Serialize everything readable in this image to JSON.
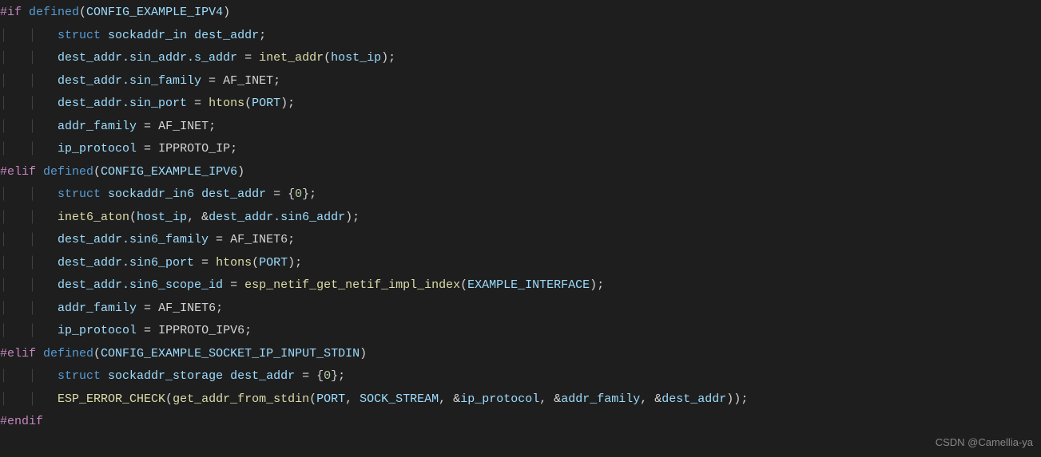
{
  "lines": {
    "l1": {
      "pre": "#if",
      "defkw": " defined",
      "op": "(",
      "macro": "CONFIG_EXAMPLE_IPV4",
      "cp": ")"
    },
    "l2": {
      "indent": "        ",
      "kw": "struct",
      "sp": " ",
      "type": "sockaddr_in",
      "sp2": " ",
      "name": "dest_addr",
      "semi": ";"
    },
    "l3": {
      "indent": "        ",
      "lhs": "dest_addr.sin_addr.s_addr",
      "eq": " = ",
      "fn": "inet_addr",
      "op": "(",
      "arg": "host_ip",
      "cp": ")",
      "semi": ";"
    },
    "l4": {
      "indent": "        ",
      "lhs": "dest_addr.sin_family",
      "eq": " = ",
      "rhs": "AF_INET",
      "semi": ";"
    },
    "l5": {
      "indent": "        ",
      "lhs": "dest_addr.sin_port",
      "eq": " = ",
      "fn": "htons",
      "op": "(",
      "arg": "PORT",
      "cp": ")",
      "semi": ";"
    },
    "l6": {
      "indent": "        ",
      "lhs": "addr_family",
      "eq": " = ",
      "rhs": "AF_INET",
      "semi": ";"
    },
    "l7": {
      "indent": "        ",
      "lhs": "ip_protocol",
      "eq": " = ",
      "rhs": "IPPROTO_IP",
      "semi": ";"
    },
    "l8": {
      "pre": "#elif",
      "defkw": " defined",
      "op": "(",
      "macro": "CONFIG_EXAMPLE_IPV6",
      "cp": ")"
    },
    "l9": {
      "indent": "        ",
      "kw": "struct",
      "sp": " ",
      "type": "sockaddr_in6",
      "sp2": " ",
      "name": "dest_addr",
      "eq": " = {",
      "num": "0",
      "cb": "};"
    },
    "l10": {
      "indent": "        ",
      "fn": "inet6_aton",
      "op": "(",
      "a1": "host_ip",
      "c": ", &",
      "a2": "dest_addr.sin6_addr",
      "cp": ")",
      "semi": ";"
    },
    "l11": {
      "indent": "        ",
      "lhs": "dest_addr.sin6_family",
      "eq": " = ",
      "rhs": "AF_INET6",
      "semi": ";"
    },
    "l12": {
      "indent": "        ",
      "lhs": "dest_addr.sin6_port",
      "eq": " = ",
      "fn": "htons",
      "op": "(",
      "arg": "PORT",
      "cp": ")",
      "semi": ";"
    },
    "l13": {
      "indent": "        ",
      "lhs": "dest_addr.sin6_scope_id",
      "eq": " = ",
      "fn": "esp_netif_get_netif_impl_index",
      "op": "(",
      "arg": "EXAMPLE_INTERFACE",
      "cp": ")",
      "semi": ";"
    },
    "l14": {
      "indent": "        ",
      "lhs": "addr_family",
      "eq": " = ",
      "rhs": "AF_INET6",
      "semi": ";"
    },
    "l15": {
      "indent": "        ",
      "lhs": "ip_protocol",
      "eq": " = ",
      "rhs": "IPPROTO_IPV6",
      "semi": ";"
    },
    "l16": {
      "pre": "#elif",
      "defkw": " defined",
      "op": "(",
      "macro": "CONFIG_EXAMPLE_SOCKET_IP_INPUT_STDIN",
      "cp": ")"
    },
    "l17": {
      "indent": "        ",
      "kw": "struct",
      "sp": " ",
      "type": "sockaddr_storage",
      "sp2": " ",
      "name": "dest_addr",
      "eq": " = {",
      "num": "0",
      "cb": "};"
    },
    "l18": {
      "indent": "        ",
      "fn": "ESP_ERROR_CHECK",
      "op": "(",
      "fn2": "get_addr_from_stdin",
      "op2": "(",
      "a1": "PORT",
      "c1": ", ",
      "a2": "SOCK_STREAM",
      "c2": ", &",
      "a3": "ip_protocol",
      "c3": ", &",
      "a4": "addr_family",
      "c4": ", &",
      "a5": "dest_addr",
      "cp": "))",
      "semi": ";"
    },
    "l19": {
      "pre": "#endif"
    }
  },
  "watermark": "CSDN @Camellia-ya",
  "guides": {
    "g1": "│   │   "
  }
}
